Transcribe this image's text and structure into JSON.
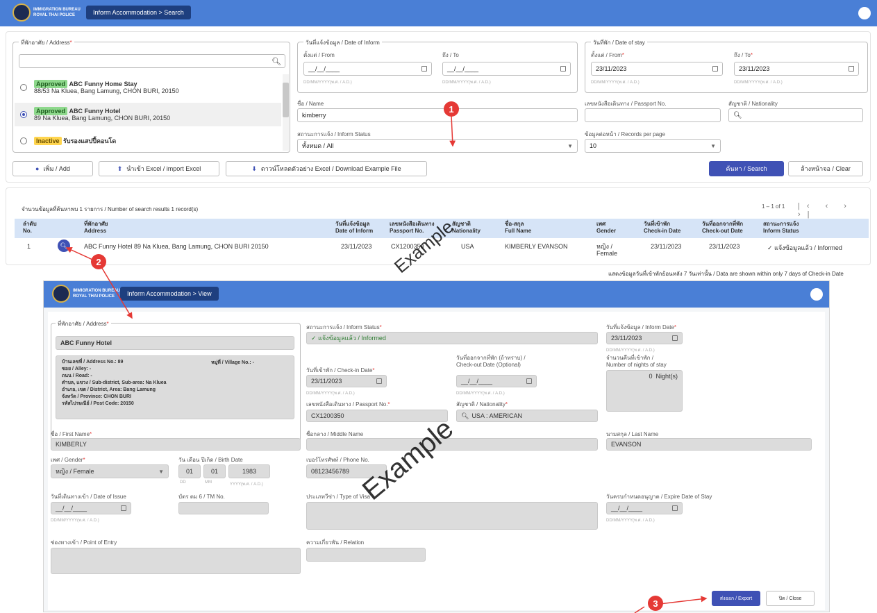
{
  "top": {
    "logo_line1": "IMMIGRATION BUREAU",
    "logo_line2": "ROYAL THAI POLICE",
    "breadcrumb": "Inform Accommodation > Search"
  },
  "search": {
    "address_legend": "ที่พักอาศัย / Address",
    "address_items": [
      {
        "status": "Approved",
        "name": "ABC Funny Home Stay",
        "addr": "88/53 Na Kluea, Bang Lamung, CHON BURI, 20150"
      },
      {
        "status": "Approved",
        "name": "ABC Funny Hotel",
        "addr": "89 Na Kluea, Bang Lamung, CHON BURI, 20150"
      },
      {
        "status": "Inactive",
        "name": "รับรองแสปปี้คอนโด",
        "addr": ""
      }
    ],
    "date_inform_legend": "วันที่แจ้งข้อมูล / Date of Inform",
    "from_label": "ตั้งแต่ / From",
    "to_label": "ถึง / To",
    "blank_date": "__/__/____",
    "date_hint": "DD/MM/YYYY(พ.ศ. / A.D.)",
    "date_stay_legend": "วันที่พัก / Date of stay",
    "stay_from": "23/11/2023",
    "stay_to": "23/11/2023",
    "name_label": "ชื่อ / Name",
    "name_value": "kimberry",
    "passport_label": "เลขหนังสือเดินทาง / Passport No.",
    "nationality_label": "สัญชาติ / Nationality",
    "inform_status_label": "สถานะการแจ้ง / Inform Status",
    "inform_status_value": "ทั้งหมด / All",
    "records_label": "ข้อมูลต่อหน้า / Records per page",
    "records_value": "10",
    "add_btn": "เพิ่ม / Add",
    "import_btn": "นำเข้า Excel / import Excel",
    "download_btn": "ดาวน์โหลดตัวอย่าง Excel / Download Example File",
    "search_btn": "ค้นหา / Search",
    "clear_btn": "ล้างหน้าจอ / Clear"
  },
  "results": {
    "count_text": "จำนวนข้อมูลที่ค้นหาพบ 1 รายการ / Number of search results 1 record(s)",
    "pagination": "1 – 1 of 1",
    "headers": [
      {
        "th": "ลำดับ",
        "en": "No."
      },
      {
        "th": "ที่พักอาศัย",
        "en": "Address"
      },
      {
        "th": "วันที่แจ้งข้อมูล",
        "en": "Date of Inform"
      },
      {
        "th": "เลขหนังสือเดินทาง",
        "en": "Passport No."
      },
      {
        "th": "สัญชาติ",
        "en": "Nationality"
      },
      {
        "th": "ชื่อ-สกุล",
        "en": "Full Name"
      },
      {
        "th": "เพศ",
        "en": "Gender"
      },
      {
        "th": "วันที่เข้าพัก",
        "en": "Check-in Date"
      },
      {
        "th": "วันที่ออกจากที่พัก",
        "en": "Check-out Date"
      },
      {
        "th": "สถานะการแจ้ง",
        "en": "Inform Status"
      }
    ],
    "row": {
      "no": "1",
      "address": "ABC Funny Hotel 89 Na Kluea, Bang Lamung, CHON BURI 20150",
      "date_inform": "23/11/2023",
      "passport": "CX1200350",
      "nationality": "USA",
      "full_name": "KIMBERLY EVANSON",
      "gender_th": "หญิง /",
      "gender_en": "Female",
      "checkin": "23/11/2023",
      "checkout": "23/11/2023",
      "status": "✓ แจ้งข้อมูลแล้ว / Informed"
    },
    "footnote": "แสดงข้อมูลวันที่เข้าพักย้อนหลัง 7 วันเท่านั้น / Data are shown within only 7 days of Check-in Date"
  },
  "view": {
    "breadcrumb": "Inform Accommodation > View",
    "address_legend": "ที่พักอาศัย / Address",
    "hotel_name": "ABC Funny Hotel",
    "address_lines": [
      "บ้านเลขที่ / Address No.: 89",
      "ซอย / Alley: -",
      "ถนน / Road: -",
      "ตำบล, แขวง / Sub-district, Sub-area: Na Kluea",
      "อำเภอ, เขต / District, Area: Bang Lamung",
      "จังหวัด / Province: CHON BURI",
      "รหัสไปรษณีย์ / Post Code: 20150"
    ],
    "village": "หมู่ที่ / Village No.: -",
    "inform_status_label": "สถานะการแจ้ง / Inform Status",
    "inform_status_value": "✓ แจ้งข้อมูลแล้ว / Informed",
    "inform_date_label": "วันที่แจ้งข้อมูล / Inform Date",
    "inform_date_value": "23/11/2023",
    "checkin_label": "วันที่เข้าพัก / Check-in Date",
    "checkin_value": "23/11/2023",
    "checkout_label1": "วันที่ออกจากที่พัก (ถ้าทราบ) /",
    "checkout_label2": "Check-out Date (Optional)",
    "nights_label1": "จำนวนคืนที่เข้าพัก /",
    "nights_label2": "Number of nights of stay",
    "nights_value": "0",
    "nights_unit": "Night(s)",
    "passport_label": "เลขหนังสือเดินทาง / Passport No.",
    "passport_value": "CX1200350",
    "nationality_label": "สัญชาติ / Nationality",
    "nationality_value": "USA : AMERICAN",
    "first_name_label": "ชื่อ / First Name",
    "first_name_value": "KIMBERLY",
    "middle_name_label": "ชื่อกลาง / Middle Name",
    "last_name_label": "นามสกุล / Last Name",
    "last_name_value": "EVANSON",
    "gender_label": "เพศ / Gender",
    "gender_value": "หญิง / Female",
    "birth_label": "วัน เดือน ปีเกิด / Birth Date",
    "birth_dd": "01",
    "birth_mm": "01",
    "birth_yyyy": "1983",
    "birth_hint_dd": "DD",
    "birth_hint_mm": "MM",
    "birth_hint_yyyy": "YYYY(พ.ศ. / A.D.)",
    "phone_label": "เบอร์โทรศัพท์ / Phone No.",
    "phone_value": "08123456789",
    "issue_label": "วันที่เดินทางเข้า / Date of Issue",
    "tm_label": "บัตร ตม 6 / TM No.",
    "visa_label": "ประเภทวีซ่า / Type of Visa",
    "expire_label": "วันครบกำหนดอนุญาต / Expire Date of Stay",
    "entry_label": "ช่องทางเข้า / Point of Entry",
    "relation_label": "ความเกี่ยวพัน / Relation",
    "export_btn": "ส่งออก / Export",
    "close_btn": "ปิด / Close"
  },
  "annotations": {
    "markers": [
      "1",
      "2",
      "3"
    ],
    "watermark": "Example",
    "marker_color": "#E53935"
  },
  "colors": {
    "topbar": "#4A7FD6",
    "crumb": "#1E3F7F",
    "primary": "#3F51B5",
    "approved": "#8ED88C",
    "inactive": "#FFD54F"
  }
}
